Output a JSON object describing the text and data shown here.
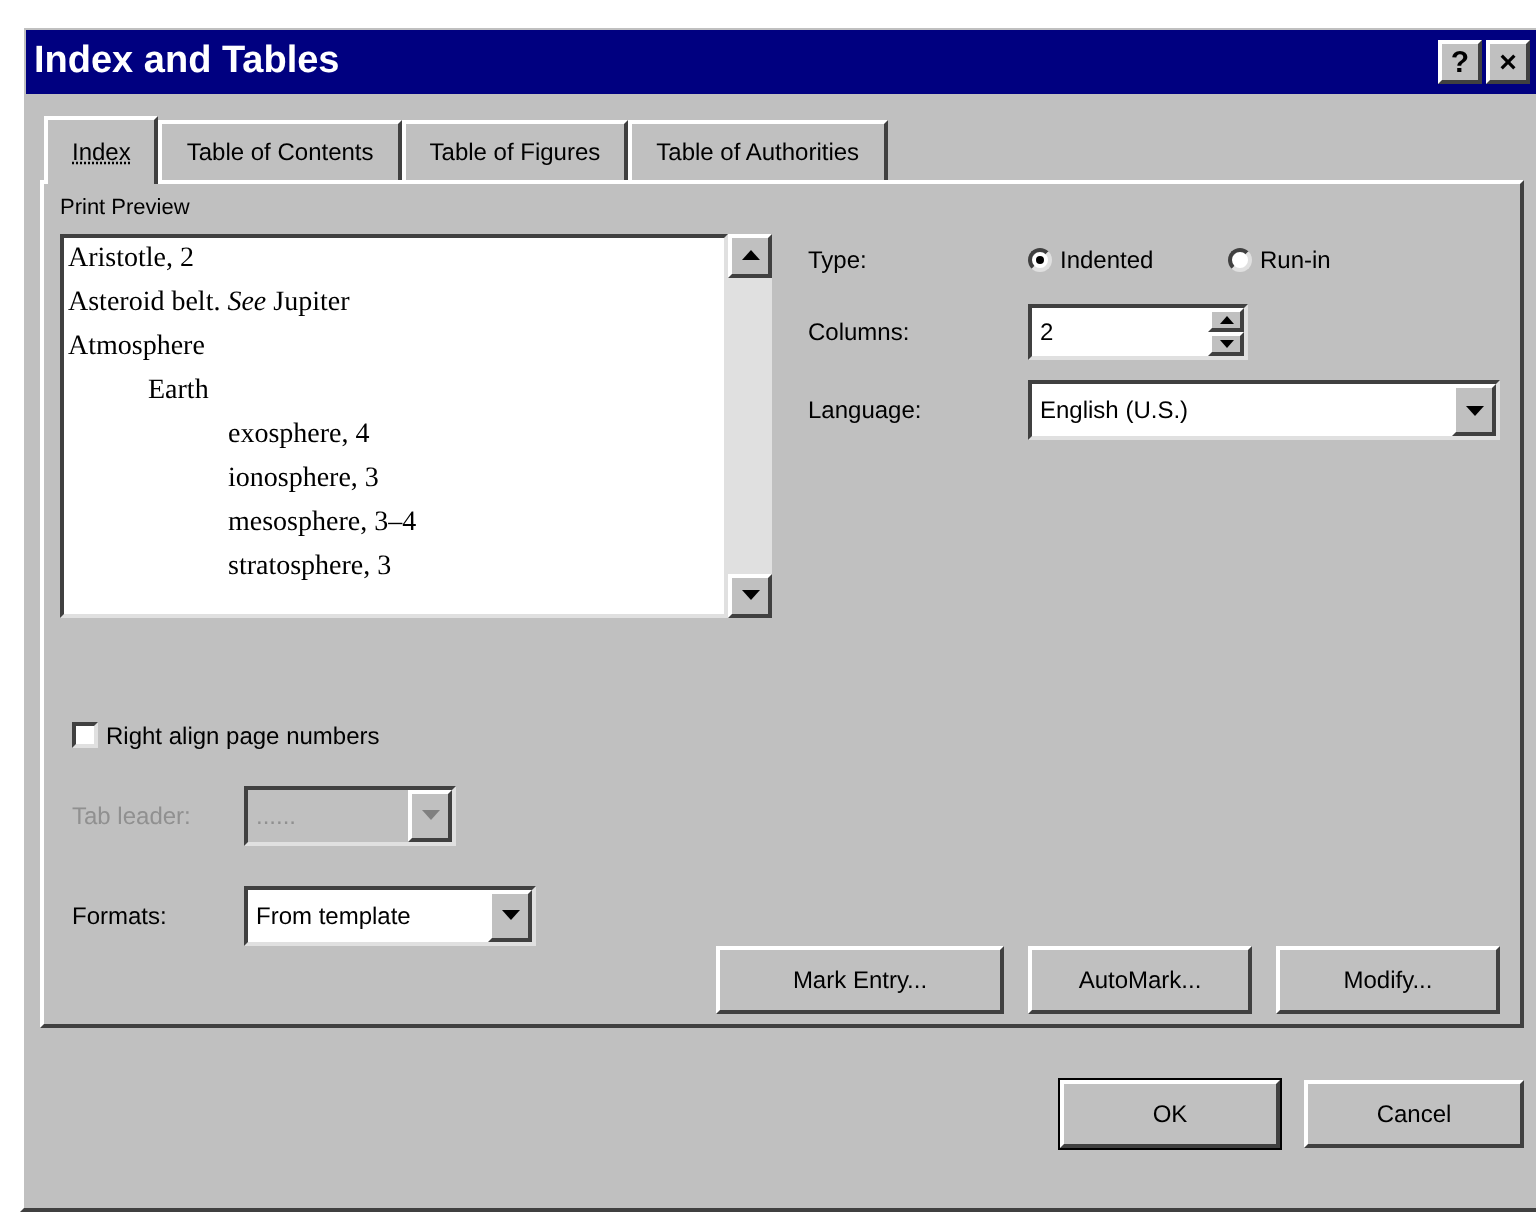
{
  "window": {
    "title": "Index and Tables",
    "title_buttons": [
      "?",
      "×"
    ]
  },
  "tabs": [
    {
      "label": "Index",
      "selected": true
    },
    {
      "label": "Table of Contents",
      "selected": false
    },
    {
      "label": "Table of Figures",
      "selected": false
    },
    {
      "label": "Table of Authorities",
      "selected": false
    }
  ],
  "preview": {
    "label": "Print Preview",
    "entries": [
      {
        "text": "Aristotle, 2"
      },
      {
        "text": "Asteroid belt. *See* Jupiter"
      },
      {
        "text": "Atmosphere",
        "children": [
          {
            "text": "Earth",
            "children": [
              {
                "text": "exosphere, 4"
              },
              {
                "text": "ionosphere, 3"
              },
              {
                "text": "mesosphere, 3–4"
              },
              {
                "text": "stratosphere, 3"
              }
            ]
          }
        ]
      }
    ]
  },
  "type": {
    "label": "Type:",
    "options": [
      {
        "label": "Indented",
        "selected": true
      },
      {
        "label": "Run-in",
        "selected": false
      }
    ]
  },
  "columns": {
    "label": "Columns:",
    "value": "2"
  },
  "language": {
    "label": "Language:",
    "value": "English (U.S.)"
  },
  "right_align": {
    "label": "Right align page numbers",
    "checked": false
  },
  "tab_leader": {
    "label": "Tab leader:",
    "value": "......",
    "disabled": true
  },
  "formats": {
    "label": "Formats:",
    "value": "From template"
  },
  "panel_buttons": [
    "Mark Entry...",
    "AutoMark...",
    "Modify..."
  ],
  "dialog_buttons": [
    "OK",
    "Cancel"
  ]
}
